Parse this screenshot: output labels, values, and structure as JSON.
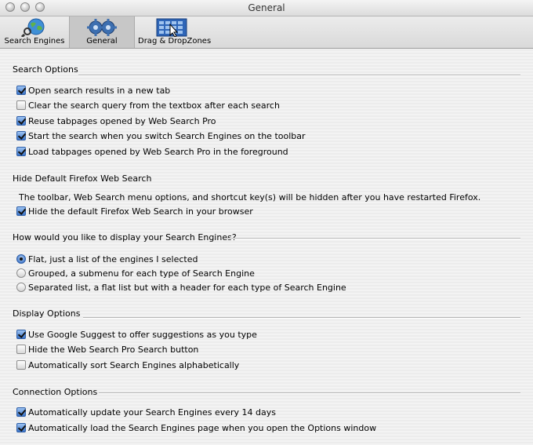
{
  "window": {
    "title": "General"
  },
  "toolbar": {
    "items": [
      {
        "label": "Search Engines",
        "icon": "globe-search-icon"
      },
      {
        "label": "General",
        "icon": "gears-icon"
      },
      {
        "label": "Drag & DropZones",
        "icon": "grid-cursor-icon"
      }
    ],
    "selected": "General"
  },
  "sections": {
    "search_options": {
      "heading": "Search Options",
      "options": [
        {
          "label": "Open search results in a new tab",
          "checked": true
        },
        {
          "label": "Clear the search query from the textbox after each search",
          "checked": false
        },
        {
          "label": "Reuse tabpages opened by Web Search Pro",
          "checked": true
        },
        {
          "label": "Start the search when you switch Search Engines on the toolbar",
          "checked": true
        },
        {
          "label": "Load tabpages opened by Web Search Pro in the foreground",
          "checked": true
        }
      ]
    },
    "hide_default": {
      "heading": "Hide Default Firefox Web Search",
      "description": "The toolbar, Web Search menu options, and shortcut key(s) will be hidden after you have restarted Firefox.",
      "options": [
        {
          "label": "Hide the default Firefox Web Search in your browser",
          "checked": true
        }
      ]
    },
    "display_engines": {
      "heading": "How would you like to display your Search Engines?",
      "options": [
        {
          "label": "Flat, just a list of the engines I selected",
          "selected": true
        },
        {
          "label": "Grouped, a submenu for each type of Search Engine",
          "selected": false
        },
        {
          "label": "Separated list, a flat list but with a header for each type of Search Engine",
          "selected": false
        }
      ]
    },
    "display_options": {
      "heading": "Display Options",
      "options": [
        {
          "label": "Use Google Suggest to offer suggestions as you type",
          "checked": true
        },
        {
          "label": "Hide the Web Search Pro Search button",
          "checked": false
        },
        {
          "label": "Automatically sort Search Engines alphabetically",
          "checked": false
        }
      ]
    },
    "connection_options": {
      "heading": "Connection Options",
      "options": [
        {
          "label": "Automatically update your Search Engines every 14 days",
          "checked": true
        },
        {
          "label": "Automatically load the Search Engines page when you open the Options window",
          "checked": true
        }
      ]
    }
  }
}
